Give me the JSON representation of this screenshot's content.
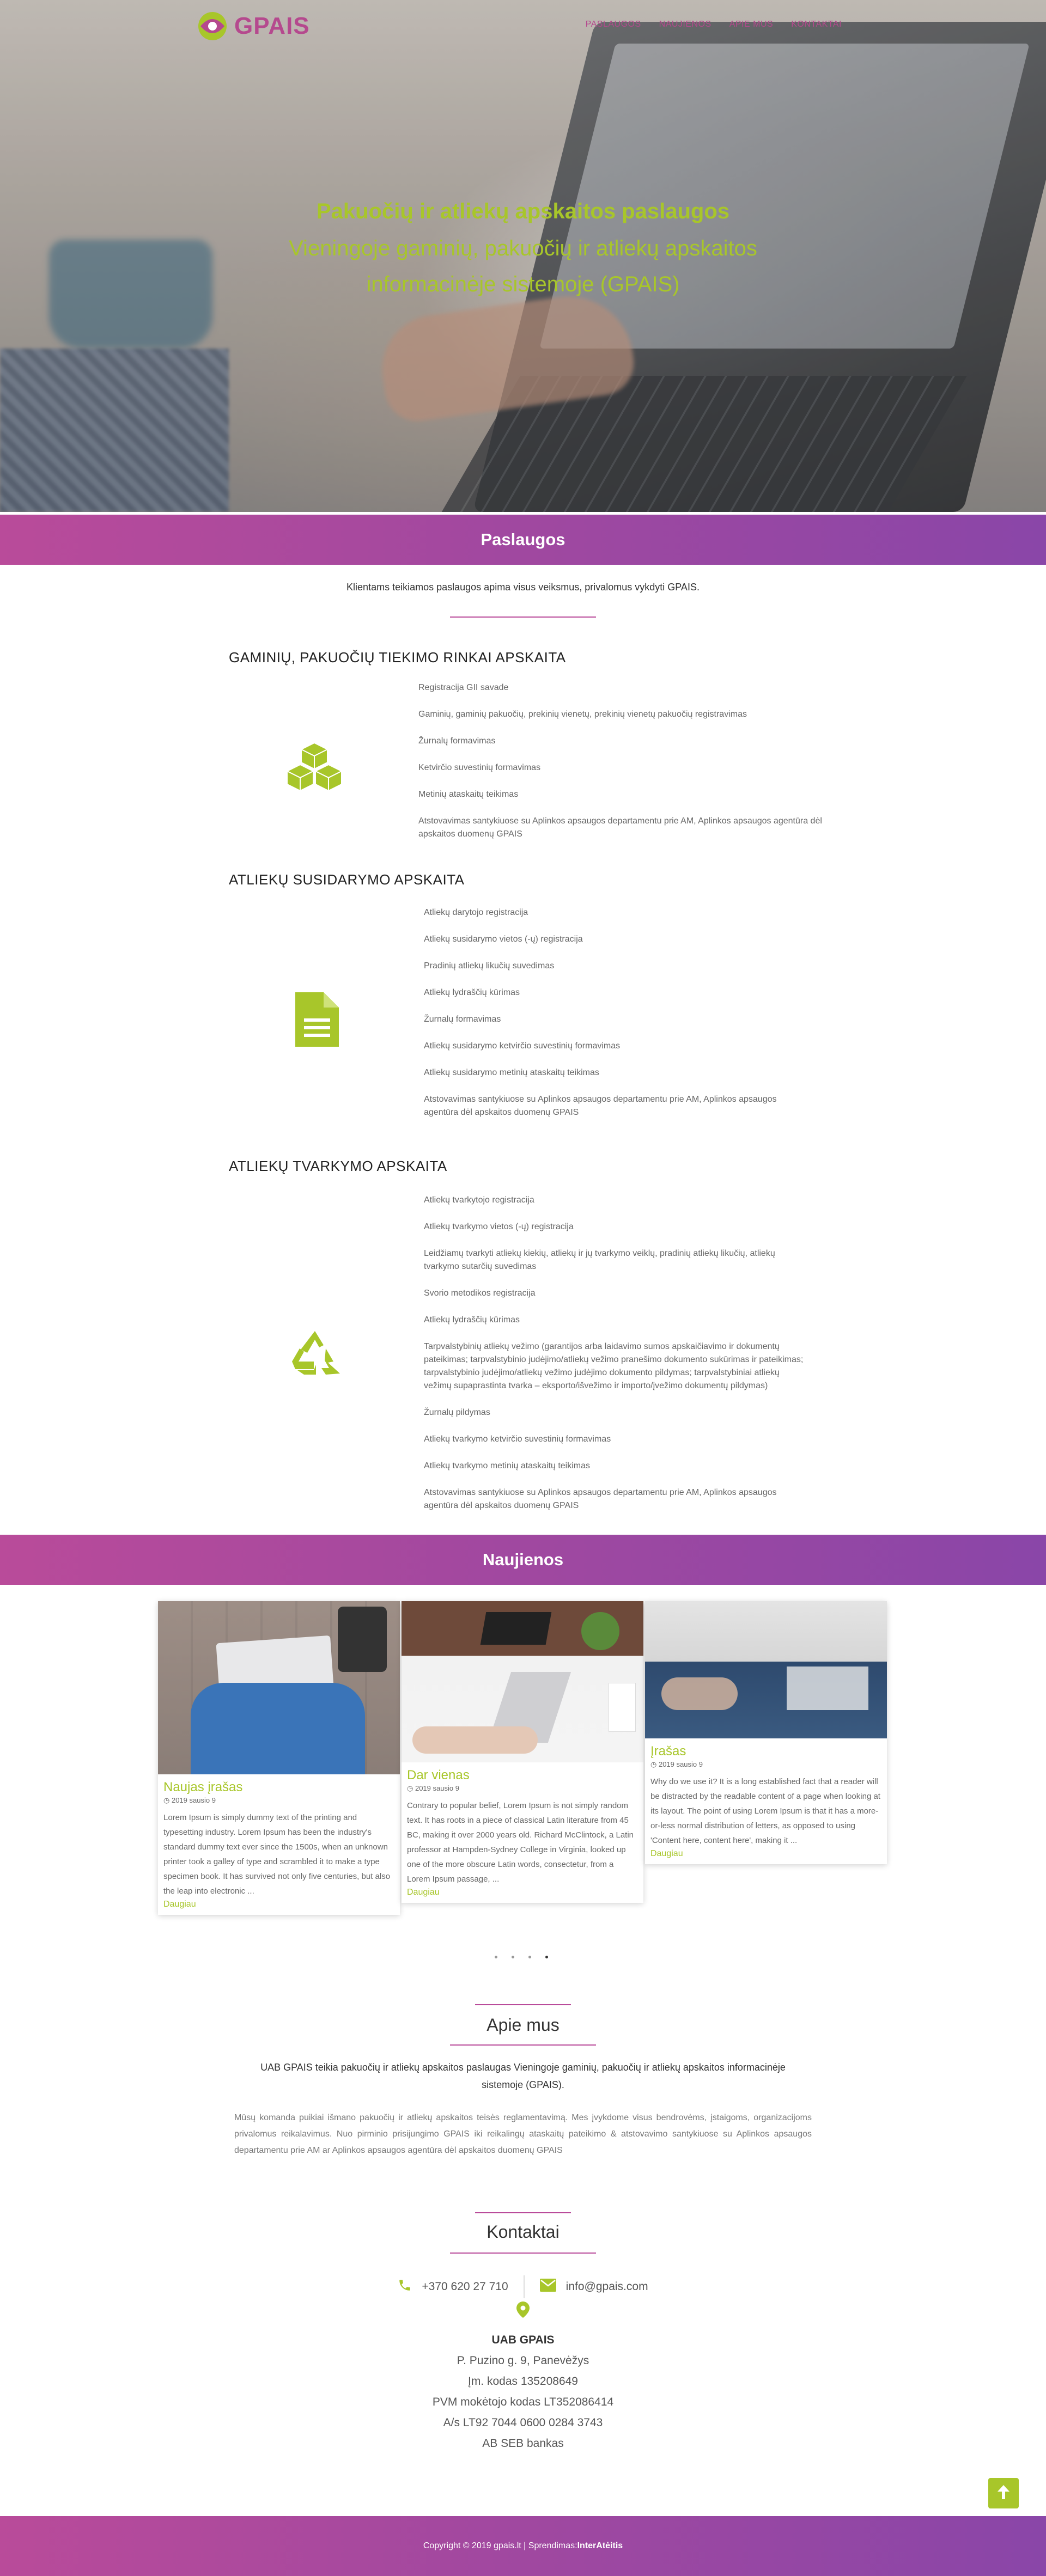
{
  "brand": {
    "name": "GPAIS",
    "accent": "#b5498e",
    "green": "#a8c62a"
  },
  "nav": {
    "items": [
      "PASLAUGOS",
      "NAUJIENOS",
      "APIE MUS",
      "KONTAKTAI"
    ]
  },
  "hero": {
    "title": "Pakuočių ir atliekų apskaitos paslaugos",
    "subtitle_line1": "Vieningoje gaminių, pakuočių ir atliekų apskaitos",
    "subtitle_line2": "informacinėje sistemoje (GPAIS)"
  },
  "services": {
    "heading": "Paslaugos",
    "intro": "Klientams teikiamos paslaugos apima visus veiksmus, privalomus vykdyti GPAIS.",
    "groups": [
      {
        "title": "GAMINIŲ, PAKUOČIŲ TIEKIMO RINKAI APSKAITA",
        "icon": "cubes-icon",
        "items": [
          "Registracija GII savade",
          "Gaminių, gaminių pakuočių, prekinių vienetų, prekinių vienetų pakuočių registravimas",
          "Žurnalų formavimas",
          "Ketvirčio suvestinių formavimas",
          "Metinių ataskaitų teikimas",
          "Atstovavimas santykiuose su Aplinkos apsaugos departamentu prie AM, Aplinkos apsaugos agentūra dėl apskaitos duomenų GPAIS"
        ]
      },
      {
        "title": "ATLIEKŲ SUSIDARYMO APSKAITA",
        "icon": "document-icon",
        "items": [
          "Atliekų darytojo registracija",
          "Atliekų susidarymo vietos (-ų) registracija",
          "Pradinių atliekų likučių suvedimas",
          "Atliekų lydraščių kūrimas",
          "Žurnalų formavimas",
          "Atliekų susidarymo ketvirčio suvestinių formavimas",
          "Atliekų susidarymo metinių ataskaitų teikimas",
          "Atstovavimas santykiuose su Aplinkos apsaugos departamentu prie AM, Aplinkos apsaugos agentūra dėl apskaitos duomenų GPAIS"
        ]
      },
      {
        "title": "ATLIEKŲ TVARKYMO APSKAITA",
        "icon": "recycle-icon",
        "items": [
          "Atliekų tvarkytojo registracija",
          "Atliekų tvarkymo vietos (-ų) registracija",
          "Leidžiamų tvarkyti atliekų kiekių, atliekų ir jų tvarkymo veiklų, pradinių atliekų likučių, atliekų tvarkymo sutarčių suvedimas",
          "Svorio metodikos registracija",
          "Atliekų lydraščių kūrimas",
          "Tarpvalstybinių atliekų vežimo (garantijos arba laidavimo sumos apskaičiavimo ir dokumentų pateikimas; tarpvalstybinio judėjimo/atliekų vežimo pranešimo dokumento sukūrimas ir pateikimas; tarpvalstybinio judėjimo/atliekų vežimo judėjimo dokumento pildymas; tarpvalstybiniai atliekų vežimų supaprastinta tvarka – eksporto/išvežimo ir importo/įvežimo dokumentų pildymas)",
          "Žurnalų pildymas",
          "Atliekų tvarkymo ketvirčio suvestinių formavimas",
          "Atliekų tvarkymo metinių ataskaitų teikimas",
          "Atstovavimas santykiuose su Aplinkos apsaugos departamentu prie AM, Aplinkos apsaugos agentūra dėl apskaitos duomenų GPAIS"
        ]
      }
    ]
  },
  "news": {
    "heading": "Naujienos",
    "posts": [
      {
        "title": "Naujas įrašas",
        "date": "2019 sausio 9",
        "text": "Lorem Ipsum is simply dummy text of the printing and typesetting industry. Lorem Ipsum has been the industry's standard dummy text ever since the 1500s, when an unknown printer took a galley of type and scrambled it to make a type specimen book. It has survived not only five centuries, but also the leap into electronic ...",
        "more": "Daugiau"
      },
      {
        "title": "Dar vienas",
        "date": "2019 sausio 9",
        "text": "Contrary to popular belief, Lorem Ipsum is not simply random text. It has roots in a piece of classical Latin literature from 45 BC, making it over 2000 years old. Richard McClintock, a Latin professor at Hampden-Sydney College in Virginia, looked up one of the more obscure Latin words, consectetur, from a Lorem Ipsum passage, ...",
        "more": "Daugiau"
      },
      {
        "title": "Įrašas",
        "date": "2019 sausio 9",
        "text": "Why do we use it? It is a long established fact that a reader will be distracted by the readable content of a page when looking at its layout. The point of using Lorem Ipsum is that it has a more-or-less normal distribution of letters, as opposed to using 'Content here, content here', making it ...",
        "more": "Daugiau"
      }
    ]
  },
  "about": {
    "heading": "Apie mus",
    "lead": "UAB GPAIS teikia pakuočių ir atliekų apskaitos paslaugas Vieningoje gaminių, pakuočių ir atliekų apskaitos informacinėje sistemoje (GPAIS).",
    "body": "Mūsų komanda puikiai išmano pakuočių ir atliekų apskaitos teisės reglamentavimą.  Mes įvykdome visus bendrovėms, įstaigoms, organizacijoms privalomus reikalavimus. Nuo pirminio prisijungimo GPAIS iki reikalingų ataskaitų pateikimo & atstovavimo santykiuose su Aplinkos apsaugos departamentu prie AM ar Aplinkos apsaugos agentūra dėl apskaitos duomenų GPAIS"
  },
  "contacts": {
    "heading": "Kontaktai",
    "phone": "+370 620 27 710",
    "email": "info@gpais.com",
    "company": "UAB GPAIS",
    "address": "P. Puzino g. 9, Panevėžys",
    "company_code": "Įm. kodas 135208649",
    "vat_code": "PVM mokėtojo kodas LT352086414",
    "account": "A/s LT92 7044 0600 0284 3743",
    "bank": "AB SEB bankas"
  },
  "footer": {
    "copyright": "Copyright © 2019 gpais.lt | Sprendimas: ",
    "credit": "InterAtėitis"
  }
}
